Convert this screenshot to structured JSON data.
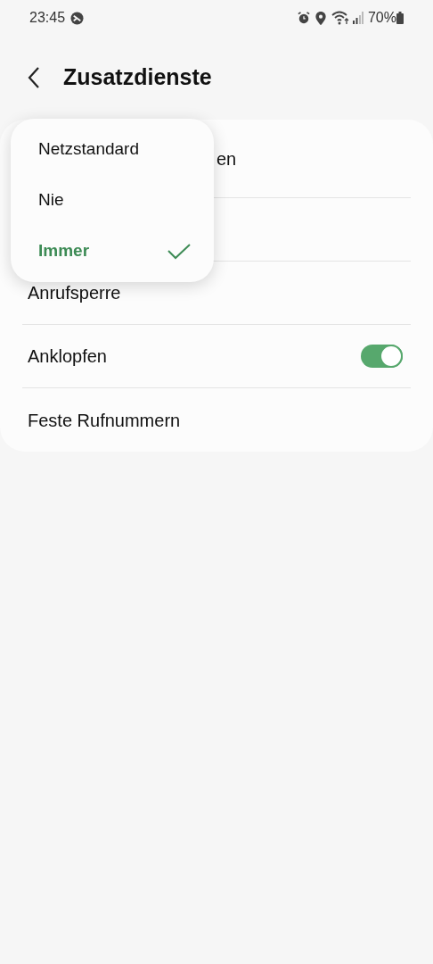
{
  "status_bar": {
    "time": "23:45",
    "battery": "70%"
  },
  "header": {
    "title": "Zusatzdienste"
  },
  "rows": [
    {
      "kind": "plain",
      "label": "en",
      "covered": true
    },
    {
      "kind": "plain",
      "covered": true
    },
    {
      "kind": "plain",
      "label": "Anrufsperre"
    },
    {
      "kind": "switch",
      "label": "Anklopfen",
      "on": true
    },
    {
      "kind": "plain",
      "label": "Feste Rufnummern"
    }
  ],
  "menu": [
    {
      "label": "Netzstandard",
      "selected": false
    },
    {
      "label": "Nie",
      "selected": false
    },
    {
      "label": "Immer",
      "selected": true
    }
  ]
}
